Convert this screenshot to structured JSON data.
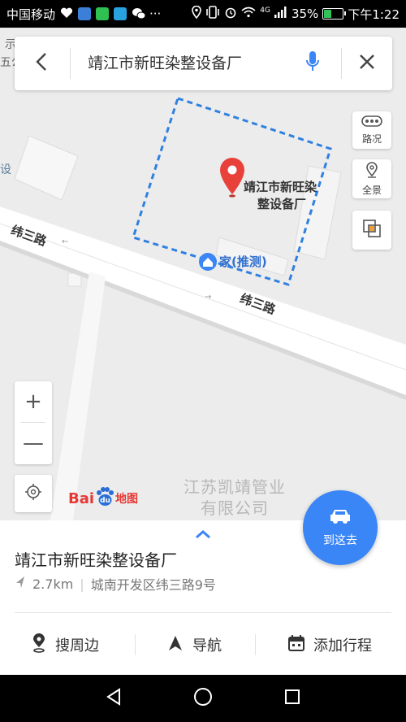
{
  "status_bar": {
    "carrier": "中国移动",
    "more": "···",
    "battery_percent": "35%",
    "battery_level": 0.35,
    "time": "下午1:22",
    "network": "4G"
  },
  "search": {
    "query": "靖江市新旺染整设备厂"
  },
  "map": {
    "edge_labels": [
      "示广",
      "五公",
      "设"
    ],
    "road_labels": [
      "纬三路",
      "纬三路"
    ],
    "poi_label_line1": "靖江市新旺染",
    "poi_label_line2": "整设备厂",
    "home_label": "家(推测)",
    "watermark_line1": "江苏凯靖管业",
    "watermark_line2": "有限公司",
    "brand_bai": "Bai",
    "brand_du": "du",
    "brand_map": "地图",
    "marker_color": "#e8413a",
    "boundary_color": "#2f80e0"
  },
  "side_controls": {
    "traffic_label": "路况",
    "panorama_label": "全景"
  },
  "zoom": {
    "plus": "+",
    "minus": "—"
  },
  "panel": {
    "name": "靖江市新旺染整设备厂",
    "distance": "2.7km",
    "address": "城南开发区纬三路9号",
    "goto_label": "到这去",
    "actions": [
      "搜周边",
      "导航",
      "添加行程"
    ],
    "accent": "#3a86f7"
  }
}
